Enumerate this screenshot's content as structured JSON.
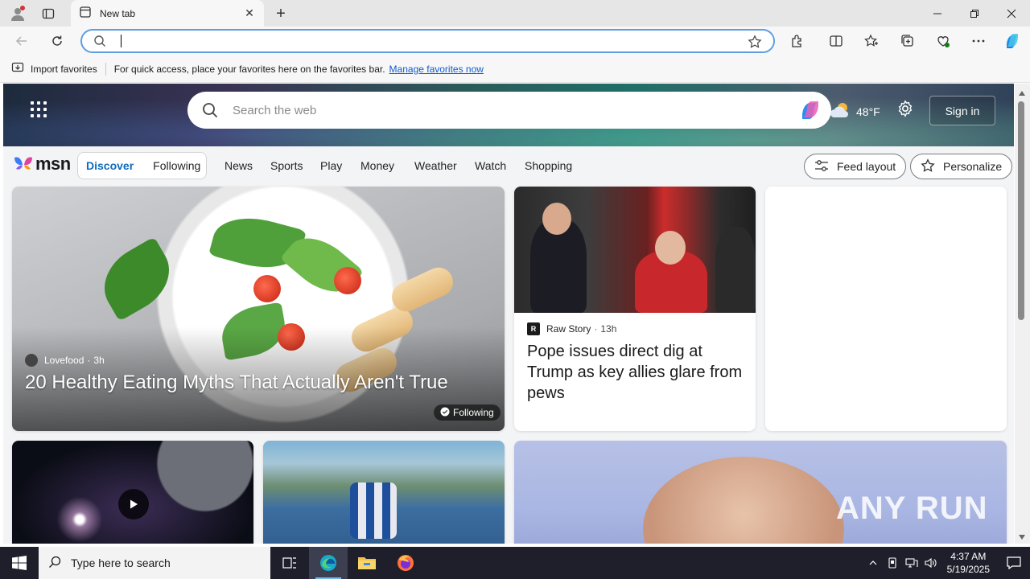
{
  "browser": {
    "tab_title": "New tab",
    "address_value": "",
    "favorites_bar": {
      "import_label": "Import favorites",
      "hint": "For quick access, place your favorites here on the favorites bar.",
      "manage_link": "Manage favorites now"
    }
  },
  "msn": {
    "search_placeholder": "Search the web",
    "weather": {
      "temp": "48°F"
    },
    "sign_in": "Sign in",
    "logo": "msn",
    "feed_tabs": [
      "Discover",
      "Following"
    ],
    "nav": [
      "News",
      "Sports",
      "Play",
      "Money",
      "Weather",
      "Watch",
      "Shopping"
    ],
    "feed_layout": "Feed layout",
    "personalize": "Personalize",
    "cards": {
      "main": {
        "source": "Lovefood",
        "age": "3h",
        "title": "20 Healthy Eating Myths That Actually Aren't True",
        "badge": "Following"
      },
      "pope": {
        "source": "Raw Story",
        "age": "13h",
        "title": "Pope issues direct dig at Trump as key allies glare from pews"
      }
    },
    "watermark": "ANY RUN"
  },
  "taskbar": {
    "search_placeholder": "Type here to search",
    "time": "4:37 AM",
    "date": "5/19/2025"
  },
  "colors": {
    "accent": "#0f6cbd",
    "address_border": "#5e9ee0",
    "taskbar": "#1f1f2b"
  }
}
